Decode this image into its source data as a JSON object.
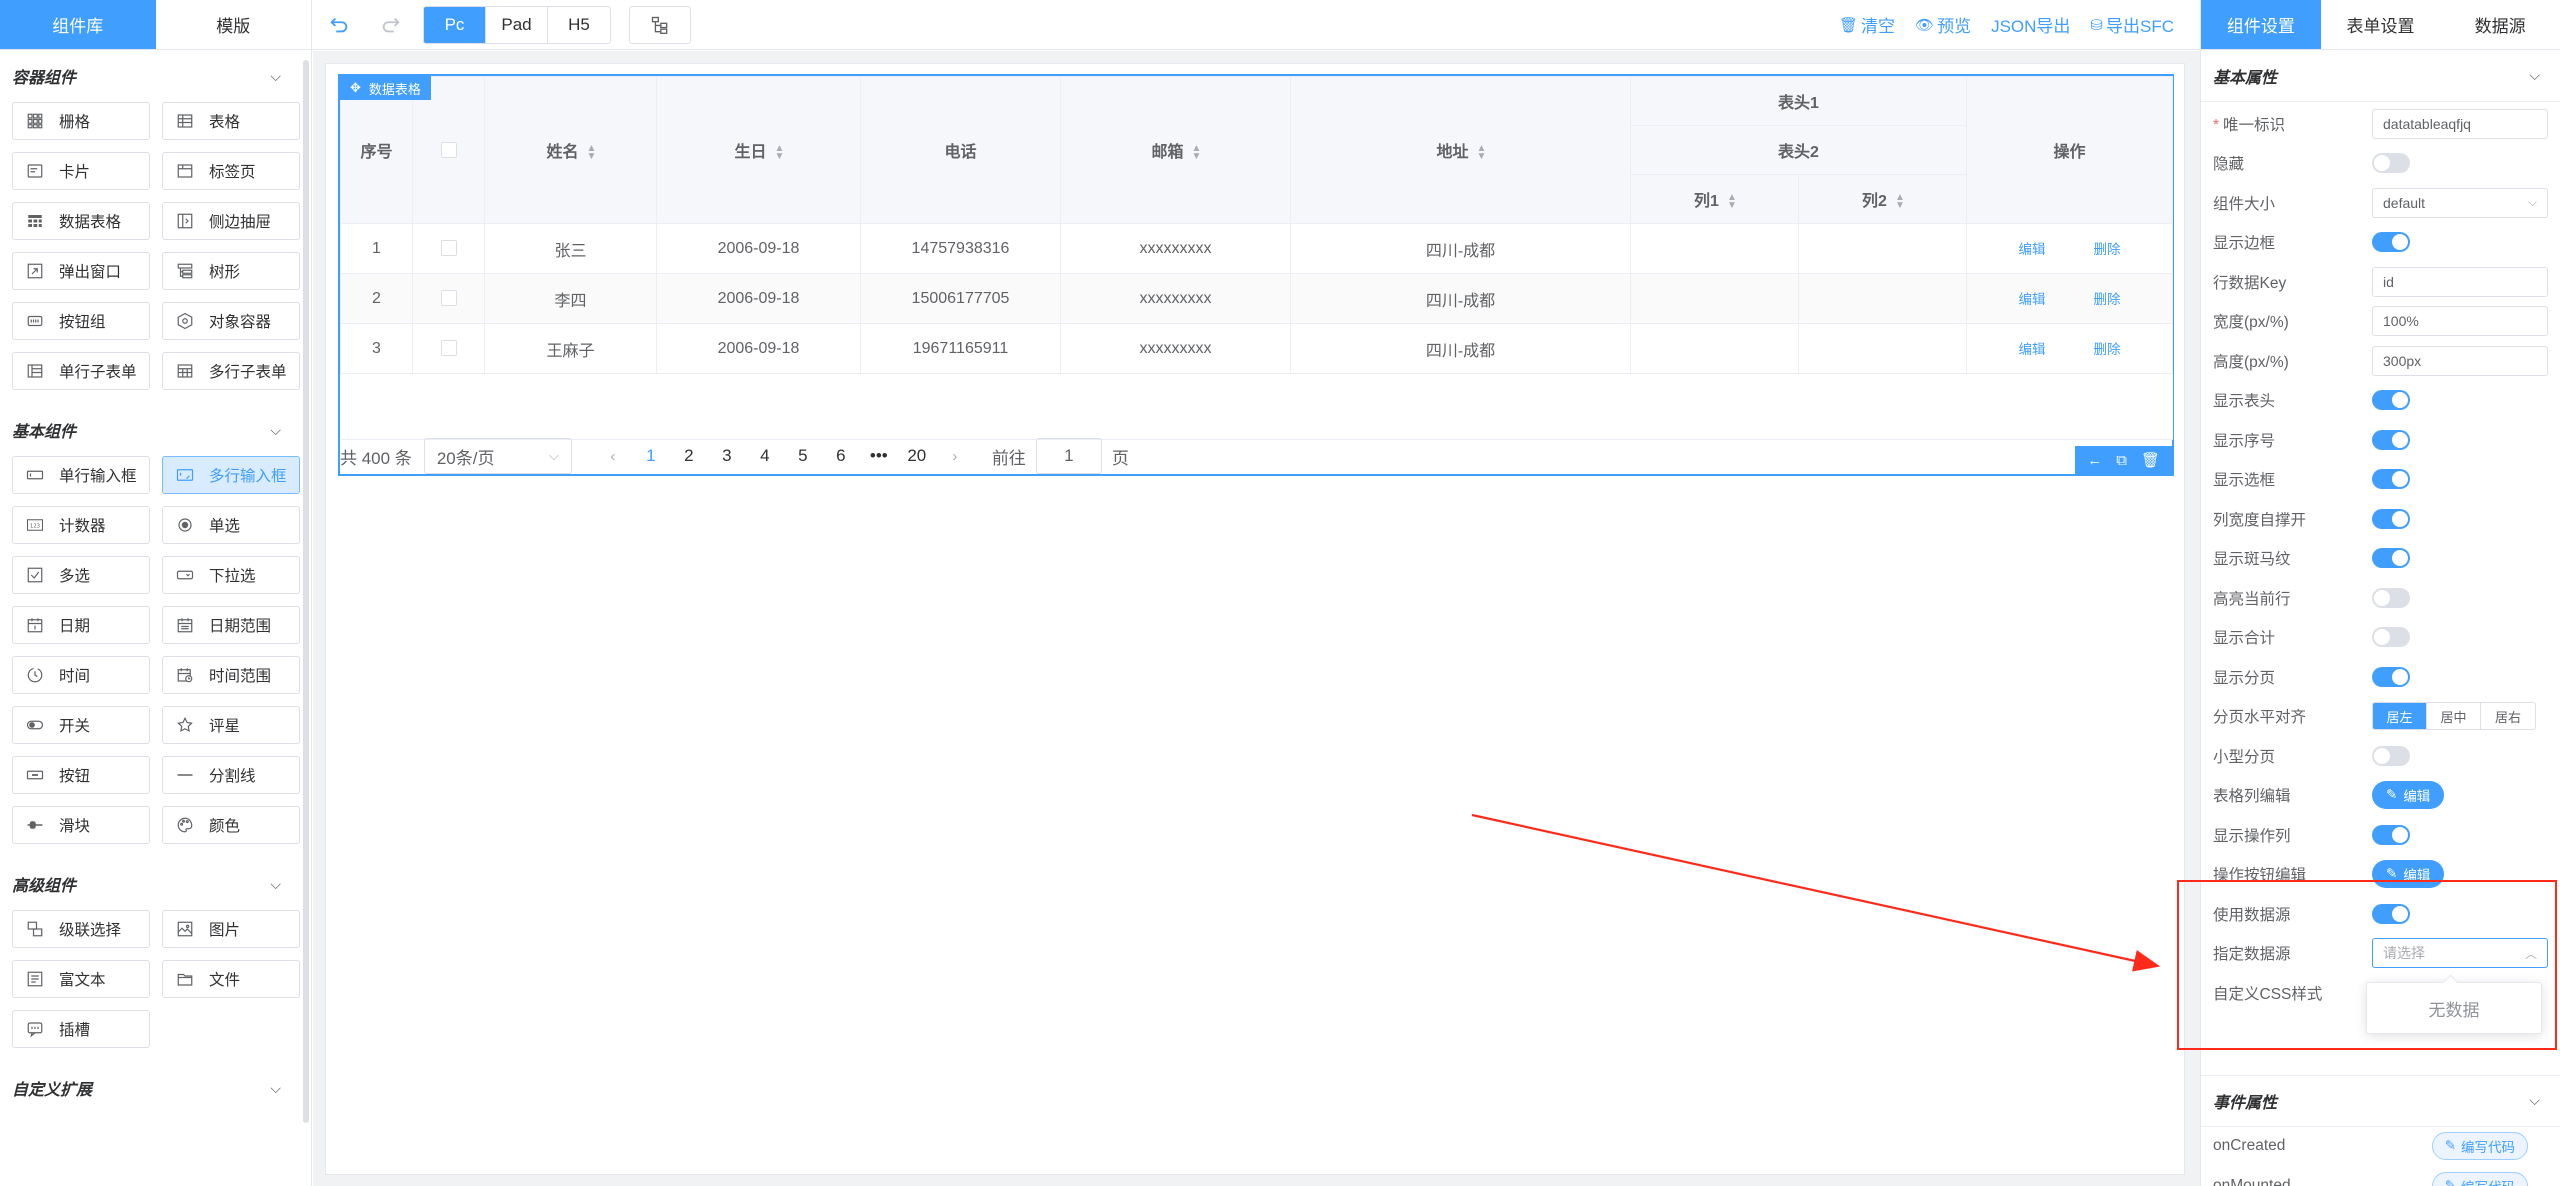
{
  "left_tabs": [
    "组件库",
    "模版"
  ],
  "groups": [
    {
      "title": "容器组件",
      "items": [
        {
          "label": "栅格",
          "icon": "grid-icon"
        },
        {
          "label": "表格",
          "icon": "table-icon"
        },
        {
          "label": "卡片",
          "icon": "card-icon"
        },
        {
          "label": "标签页",
          "icon": "tabs-icon"
        },
        {
          "label": "数据表格",
          "icon": "data-table-icon"
        },
        {
          "label": "侧边抽屉",
          "icon": "drawer-icon"
        },
        {
          "label": "弹出窗口",
          "icon": "dialog-icon"
        },
        {
          "label": "树形",
          "icon": "tree-icon"
        },
        {
          "label": "按钮组",
          "icon": "button-group-icon"
        },
        {
          "label": "对象容器",
          "icon": "object-container-icon"
        },
        {
          "label": "单行子表单",
          "icon": "sub-form-icon"
        },
        {
          "label": "多行子表单",
          "icon": "grid-sub-form-icon"
        }
      ]
    },
    {
      "title": "基本组件",
      "items": [
        {
          "label": "单行输入框",
          "icon": "input-icon"
        },
        {
          "label": "多行输入框",
          "icon": "textarea-icon",
          "selected": true
        },
        {
          "label": "计数器",
          "icon": "number-icon"
        },
        {
          "label": "单选",
          "icon": "radio-icon"
        },
        {
          "label": "多选",
          "icon": "checkbox-icon"
        },
        {
          "label": "下拉选",
          "icon": "select-icon"
        },
        {
          "label": "日期",
          "icon": "date-icon"
        },
        {
          "label": "日期范围",
          "icon": "date-range-icon"
        },
        {
          "label": "时间",
          "icon": "time-icon"
        },
        {
          "label": "时间范围",
          "icon": "time-range-icon"
        },
        {
          "label": "开关",
          "icon": "switch-icon"
        },
        {
          "label": "评星",
          "icon": "star-icon"
        },
        {
          "label": "按钮",
          "icon": "button-icon"
        },
        {
          "label": "分割线",
          "icon": "divider-icon"
        },
        {
          "label": "滑块",
          "icon": "slider-icon"
        },
        {
          "label": "颜色",
          "icon": "color-icon"
        }
      ]
    },
    {
      "title": "高级组件",
      "items": [
        {
          "label": "级联选择",
          "icon": "cascader-icon"
        },
        {
          "label": "图片",
          "icon": "picture-icon"
        },
        {
          "label": "富文本",
          "icon": "rich-text-icon"
        },
        {
          "label": "文件",
          "icon": "file-icon"
        },
        {
          "label": "插槽",
          "icon": "slot-icon"
        }
      ]
    },
    {
      "title": "自定义扩展",
      "items": []
    }
  ],
  "toolbar": {
    "devices": [
      "Pc",
      "Pad",
      "H5"
    ],
    "active_device": "Pc",
    "actions": [
      {
        "label": "清空",
        "icon": "trash-icon"
      },
      {
        "label": "预览",
        "icon": "eye-icon"
      },
      {
        "label": "JSON导出",
        "icon": ""
      },
      {
        "label": "导出SFC",
        "icon": "database-icon"
      }
    ]
  },
  "widget": {
    "label": "数据表格",
    "table": {
      "headers": {
        "index": "序号",
        "name": "姓名",
        "birthday": "生日",
        "phone": "电话",
        "email": "邮箱",
        "address": "地址",
        "group1": "表头1",
        "group2": "表头2",
        "col1": "列1",
        "col2": "列2",
        "ops": "操作"
      },
      "rows": [
        {
          "index": "1",
          "name": "张三",
          "birthday": "2006-09-18",
          "phone": "14757938316",
          "email": "xxxxxxxxx",
          "address": "四川-成都"
        },
        {
          "index": "2",
          "name": "李四",
          "birthday": "2006-09-18",
          "phone": "15006177705",
          "email": "xxxxxxxxx",
          "address": "四川-成都"
        },
        {
          "index": "3",
          "name": "王麻子",
          "birthday": "2006-09-18",
          "phone": "19671165911",
          "email": "xxxxxxxxx",
          "address": "四川-成都"
        }
      ],
      "row_actions": [
        "编辑",
        "删除"
      ]
    },
    "pager": {
      "total": "共 400 条",
      "page_size": "20条/页",
      "pages": [
        "1",
        "2",
        "3",
        "4",
        "5",
        "6",
        "•••",
        "20"
      ],
      "current": "1",
      "goto_prefix": "前往",
      "goto_value": "1",
      "goto_suffix": "页"
    }
  },
  "right_tabs": [
    "组件设置",
    "表单设置",
    "数据源"
  ],
  "basic_section": "基本属性",
  "props": [
    {
      "label": "唯一标识",
      "required": true,
      "type": "input",
      "value": "datatableaqfjq"
    },
    {
      "label": "隐藏",
      "type": "switch",
      "on": false
    },
    {
      "label": "组件大小",
      "type": "select",
      "value": "default"
    },
    {
      "label": "显示边框",
      "type": "switch",
      "on": true
    },
    {
      "label": "行数据Key",
      "type": "input",
      "value": "id"
    },
    {
      "label": "宽度(px/%)",
      "type": "input",
      "value": "100%"
    },
    {
      "label": "高度(px/%)",
      "type": "input",
      "value": "300px"
    },
    {
      "label": "显示表头",
      "type": "switch",
      "on": true
    },
    {
      "label": "显示序号",
      "type": "switch",
      "on": true
    },
    {
      "label": "显示选框",
      "type": "switch",
      "on": true
    },
    {
      "label": "列宽度自撑开",
      "type": "switch",
      "on": true
    },
    {
      "label": "显示斑马纹",
      "type": "switch",
      "on": true
    },
    {
      "label": "高亮当前行",
      "type": "switch",
      "on": false
    },
    {
      "label": "显示合计",
      "type": "switch",
      "on": false
    },
    {
      "label": "显示分页",
      "type": "switch",
      "on": true
    },
    {
      "label": "分页水平对齐",
      "type": "segment",
      "options": [
        "居左",
        "居中",
        "居右"
      ],
      "active": 0
    },
    {
      "label": "小型分页",
      "type": "switch",
      "on": false
    },
    {
      "label": "表格列编辑",
      "type": "edit",
      "value": "编辑"
    },
    {
      "label": "显示操作列",
      "type": "switch",
      "on": true
    },
    {
      "label": "操作按钮编辑",
      "type": "edit",
      "value": "编辑"
    },
    {
      "label": "使用数据源",
      "type": "switch",
      "on": true
    },
    {
      "label": "指定数据源",
      "type": "select-open",
      "placeholder": "请选择"
    },
    {
      "label": "自定义CSS样式",
      "type": "none"
    }
  ],
  "dropdown_empty": "无数据",
  "event_section": "事件属性",
  "events": [
    {
      "label": "onCreated",
      "button": "编写代码"
    },
    {
      "label": "onMounted",
      "button": "编写代码"
    }
  ],
  "colors": {
    "accent": "#409eff",
    "annotation": "#ff2a1a"
  }
}
